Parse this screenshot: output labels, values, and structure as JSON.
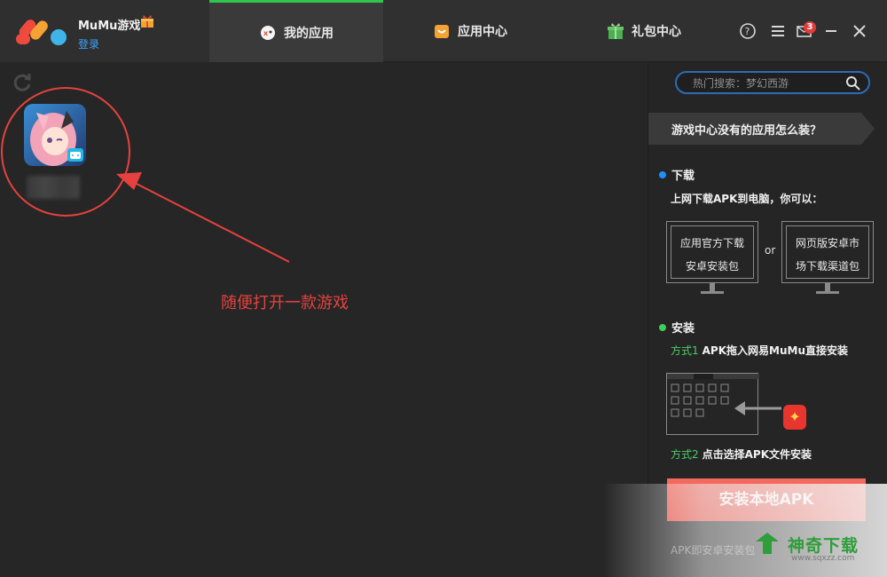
{
  "brand": {
    "name": "MuMu游戏",
    "login_label": "登录"
  },
  "tabs": [
    {
      "label": "我的应用",
      "icon": "mascot-icon",
      "active": true
    },
    {
      "label": "应用中心",
      "icon": "shopping-bag-icon",
      "active": false
    },
    {
      "label": "礼包中心",
      "icon": "gift-icon",
      "active": false
    }
  ],
  "window_controls": {
    "mail_badge": "3"
  },
  "annotation": {
    "text": "随便打开一款游戏",
    "color": "#e5423f"
  },
  "right_panel": {
    "search_placeholder": "热门搜索：梦幻西游",
    "faq": "游戏中心没有的应用怎么装？",
    "download": {
      "title": "下载",
      "desc": "上网下载APK到电脑，你可以：",
      "option1_line1": "应用官方下载",
      "option1_line2": "安卓安装包",
      "or": "or",
      "option2_line1": "网页版安卓市",
      "option2_line2": "场下载渠道包"
    },
    "install": {
      "title": "安装",
      "method1_label": "方式1",
      "method1_text": "APK拖入网易MuMu直接安装",
      "method2_label": "方式2",
      "method2_text": "点击选择APK文件安装",
      "button": "安装本地APK",
      "hint": "APK即安卓安装包"
    }
  },
  "watermark": {
    "name": "神奇下载",
    "url": "www.sqxzz.com"
  },
  "colors": {
    "accent_green": "#2fc54f",
    "link_blue": "#3ea6ff",
    "install_red": "#ee5448",
    "download_dot": "#1e90ff",
    "install_dot": "#3fce5c"
  }
}
